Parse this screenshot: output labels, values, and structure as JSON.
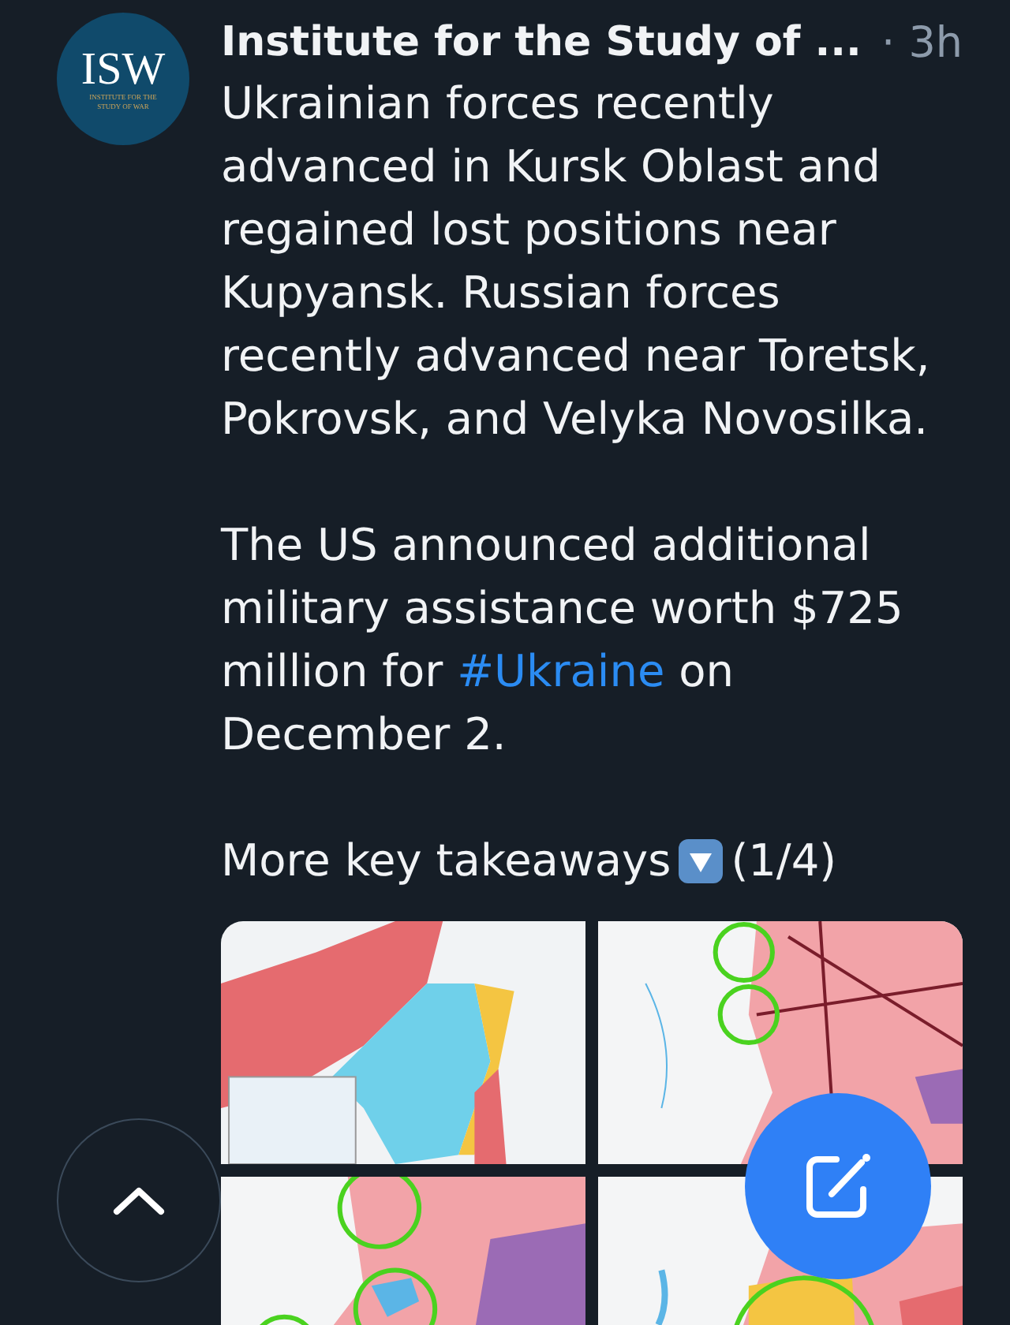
{
  "post": {
    "avatar": {
      "letters": "ISW",
      "line_1": "INSTITUTE FOR THE",
      "line_2": "STUDY OF WAR"
    },
    "author": "Institute for the Study of ...",
    "time": "· 3h",
    "paragraphs": [
      {
        "before": "Ukrainian forces recently advanced in Kursk Oblast and regained lost positions near Kupyansk. Russian forces recently advanced near Toretsk, Pokrovsk, and Velyka Novosilka."
      },
      {
        "before": "The US announced additional military assistance worth $725 million for ",
        "link": "#Ukraine",
        "after": " on December 2."
      }
    ],
    "footer_text": "More key takeaways",
    "footer_count": "(1/4)"
  }
}
